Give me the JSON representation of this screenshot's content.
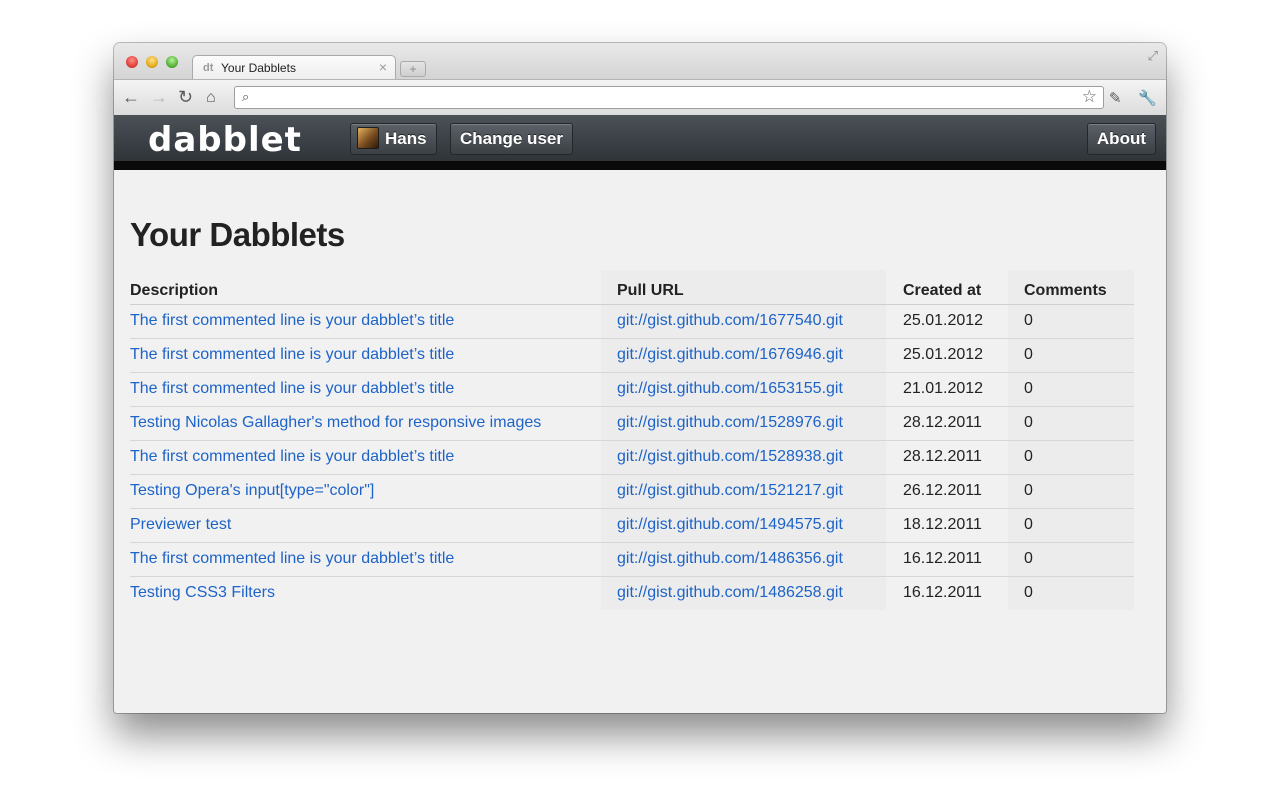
{
  "browser": {
    "tab_title": "Your Dabblets",
    "tab_favicon": "dt",
    "tab_close": "×",
    "new_tab": "+",
    "address": "",
    "icons": [
      "back-icon",
      "forward-icon",
      "reload-icon",
      "home-icon",
      "search-icon",
      "star-icon",
      "extension-icon",
      "wrench-icon",
      "fullscreen-icon"
    ]
  },
  "header": {
    "logo": "dabblet",
    "user_label": "Hans",
    "change_user_label": "Change user",
    "about_label": "About"
  },
  "page": {
    "title": "Your Dabblets",
    "columns": [
      "Description",
      "Pull URL",
      "Created at",
      "Comments"
    ],
    "rows": [
      {
        "description": "The first commented line is your dabblet’s title",
        "url": "git://gist.github.com/1677540.git",
        "created": "25.01.2012",
        "comments": "0"
      },
      {
        "description": "The first commented line is your dabblet’s title",
        "url": "git://gist.github.com/1676946.git",
        "created": "25.01.2012",
        "comments": "0"
      },
      {
        "description": "The first commented line is your dabblet’s title",
        "url": "git://gist.github.com/1653155.git",
        "created": "21.01.2012",
        "comments": "0"
      },
      {
        "description": "Testing Nicolas Gallagher's method for responsive images",
        "url": "git://gist.github.com/1528976.git",
        "created": "28.12.2011",
        "comments": "0"
      },
      {
        "description": "The first commented line is your dabblet’s title",
        "url": "git://gist.github.com/1528938.git",
        "created": "28.12.2011",
        "comments": "0"
      },
      {
        "description": "Testing Opera's input[type=\"color\"]",
        "url": "git://gist.github.com/1521217.git",
        "created": "26.12.2011",
        "comments": "0"
      },
      {
        "description": "Previewer test",
        "url": "git://gist.github.com/1494575.git",
        "created": "18.12.2011",
        "comments": "0"
      },
      {
        "description": "The first commented line is your dabblet’s title",
        "url": "git://gist.github.com/1486356.git",
        "created": "16.12.2011",
        "comments": "0"
      },
      {
        "description": "Testing CSS3 Filters",
        "url": "git://gist.github.com/1486258.git",
        "created": "16.12.2011",
        "comments": "0"
      }
    ]
  },
  "colors": {
    "link": "#1d63c8",
    "header_bg": "#3b4045",
    "page_bg": "#f1f1f1"
  }
}
